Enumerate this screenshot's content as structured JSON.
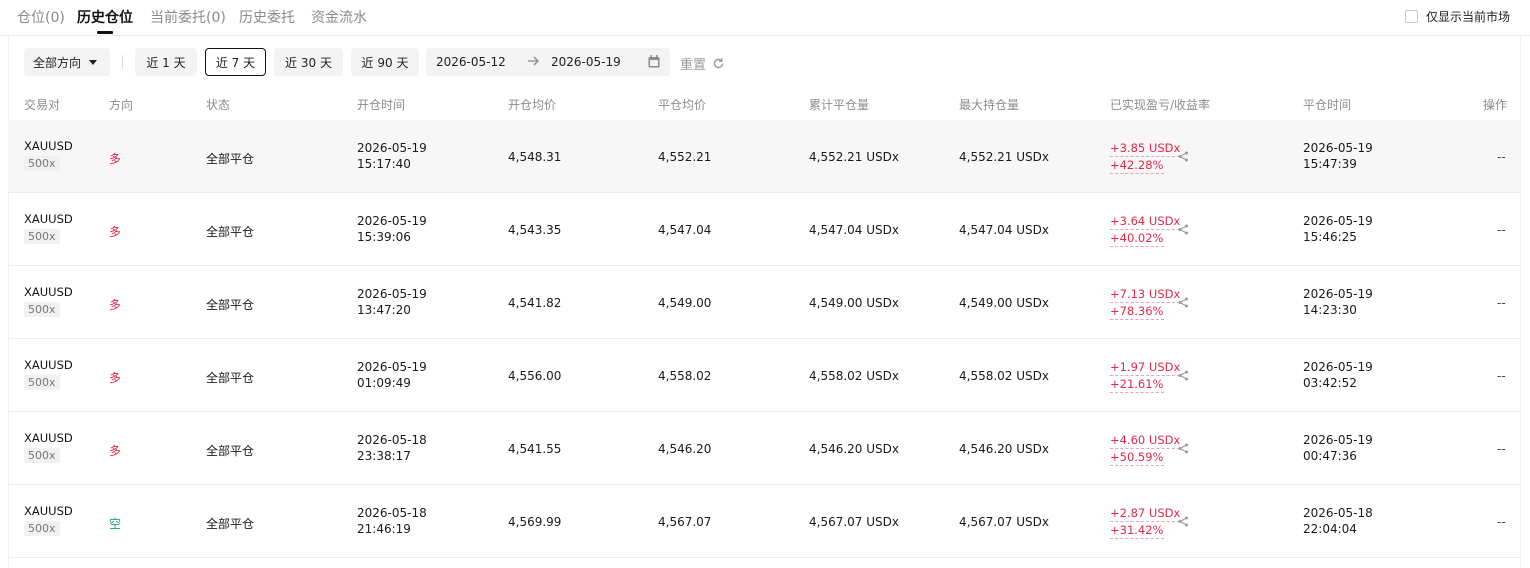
{
  "tabs": [
    {
      "label": "仓位(0)"
    },
    {
      "label": "历史仓位"
    },
    {
      "label": "当前委托(0)"
    },
    {
      "label": "历史委托"
    },
    {
      "label": "资金流水"
    }
  ],
  "only_current_market_label": "仅显示当前市场",
  "filters": {
    "direction": "全部方向",
    "ranges": [
      "近 1 天",
      "近 7 天",
      "近 30 天",
      "近 90 天"
    ],
    "selected_range": "近 7 天",
    "date_from": "2026-05-12",
    "date_to": "2026-05-19",
    "reset_label": "重置"
  },
  "columns": [
    "交易对",
    "方向",
    "状态",
    "开仓时间",
    "开仓均价",
    "平仓均价",
    "累计平仓量",
    "最大持仓量",
    "已实现盈亏/收益率",
    "平仓时间",
    "操作"
  ],
  "rows": [
    {
      "symbol": "XAUUSD",
      "leverage": "500x",
      "direction": "多",
      "status": "全部平仓",
      "open_date": "2026-05-19",
      "open_time": "15:17:40",
      "open_price": "4,548.31",
      "close_price": "4,552.21",
      "cum_close": "4,552.21 USDx",
      "max_pos": "4,552.21 USDx",
      "pnl": "+3.85 USDx",
      "roi": "+42.28%",
      "close_date": "2026-05-19",
      "close_time": "15:47:39",
      "action": "--"
    },
    {
      "symbol": "XAUUSD",
      "leverage": "500x",
      "direction": "多",
      "status": "全部平仓",
      "open_date": "2026-05-19",
      "open_time": "15:39:06",
      "open_price": "4,543.35",
      "close_price": "4,547.04",
      "cum_close": "4,547.04 USDx",
      "max_pos": "4,547.04 USDx",
      "pnl": "+3.64 USDx",
      "roi": "+40.02%",
      "close_date": "2026-05-19",
      "close_time": "15:46:25",
      "action": "--"
    },
    {
      "symbol": "XAUUSD",
      "leverage": "500x",
      "direction": "多",
      "status": "全部平仓",
      "open_date": "2026-05-19",
      "open_time": "13:47:20",
      "open_price": "4,541.82",
      "close_price": "4,549.00",
      "cum_close": "4,549.00 USDx",
      "max_pos": "4,549.00 USDx",
      "pnl": "+7.13 USDx",
      "roi": "+78.36%",
      "close_date": "2026-05-19",
      "close_time": "14:23:30",
      "action": "--"
    },
    {
      "symbol": "XAUUSD",
      "leverage": "500x",
      "direction": "多",
      "status": "全部平仓",
      "open_date": "2026-05-19",
      "open_time": "01:09:49",
      "open_price": "4,556.00",
      "close_price": "4,558.02",
      "cum_close": "4,558.02 USDx",
      "max_pos": "4,558.02 USDx",
      "pnl": "+1.97 USDx",
      "roi": "+21.61%",
      "close_date": "2026-05-19",
      "close_time": "03:42:52",
      "action": "--"
    },
    {
      "symbol": "XAUUSD",
      "leverage": "500x",
      "direction": "多",
      "status": "全部平仓",
      "open_date": "2026-05-18",
      "open_time": "23:38:17",
      "open_price": "4,541.55",
      "close_price": "4,546.20",
      "cum_close": "4,546.20 USDx",
      "max_pos": "4,546.20 USDx",
      "pnl": "+4.60 USDx",
      "roi": "+50.59%",
      "close_date": "2026-05-19",
      "close_time": "00:47:36",
      "action": "--"
    },
    {
      "symbol": "XAUUSD",
      "leverage": "500x",
      "direction": "空",
      "status": "全部平仓",
      "open_date": "2026-05-18",
      "open_time": "21:46:19",
      "open_price": "4,569.99",
      "close_price": "4,567.07",
      "cum_close": "4,567.07 USDx",
      "max_pos": "4,567.07 USDx",
      "pnl": "+2.87 USDx",
      "roi": "+31.42%",
      "close_date": "2026-05-18",
      "close_time": "22:04:04",
      "action": "--"
    }
  ],
  "colors": {
    "long": "#e0294a",
    "short": "#1ba27a",
    "profit": "#e0294a"
  }
}
